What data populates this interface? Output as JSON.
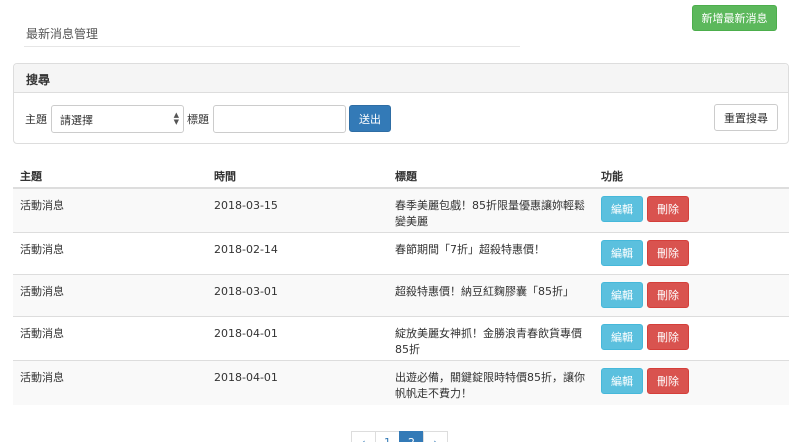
{
  "header": {
    "page_title": "最新消息管理",
    "add_button": "新增最新消息"
  },
  "search": {
    "panel_title": "搜尋",
    "topic_label": "主題",
    "topic_select_value": "請選擇",
    "title_label": "標題",
    "title_input_value": "",
    "submit_label": "送出",
    "reset_label": "重置搜尋"
  },
  "table": {
    "headers": [
      "主題",
      "時間",
      "標題",
      "功能"
    ],
    "edit_label": "編輯",
    "delete_label": "刪除",
    "rows": [
      {
        "topic": "活動消息",
        "time": "2018-03-15",
        "title": "春季美麗包戲！85折限量優惠讓妳輕鬆變美麗"
      },
      {
        "topic": "活動消息",
        "time": "2018-02-14",
        "title": "春節期間「7折」超殺特惠價！"
      },
      {
        "topic": "活動消息",
        "time": "2018-03-01",
        "title": "超殺特惠價！納豆紅麴膠囊「85折」"
      },
      {
        "topic": "活動消息",
        "time": "2018-04-01",
        "title": "綻放美麗女神抓！金勝浪青春飲貨專價85折"
      },
      {
        "topic": "活動消息",
        "time": "2018-04-01",
        "title": "出遊必備，關鍵錠限時特價85折，讓你帆帆走不費力！"
      }
    ]
  },
  "pagination": {
    "pages": [
      "‹",
      "1",
      "2",
      "›"
    ],
    "active_index": 2
  }
}
